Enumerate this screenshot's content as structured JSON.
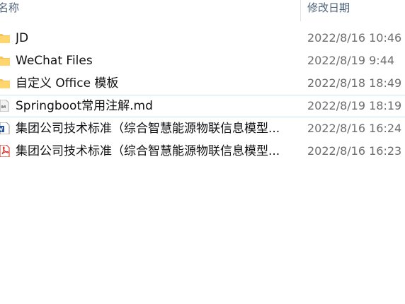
{
  "columns": {
    "name": "名称",
    "modified": "修改日期"
  },
  "files": [
    {
      "name": "JD",
      "modified": "2022/8/16 10:46",
      "icon": "folder-icon",
      "color": "#f4c25b"
    },
    {
      "name": "WeChat Files",
      "modified": "2022/8/19 9:44",
      "icon": "folder-icon",
      "color": "#f4c25b"
    },
    {
      "name": "自定义 Office 模板",
      "modified": "2022/8/18 18:49",
      "icon": "folder-icon",
      "color": "#f4c25b"
    },
    {
      "name": "Springboot常用注解.md",
      "modified": "2022/8/19 18:19",
      "icon": "markdown-file-icon",
      "focused": true
    },
    {
      "name": "集团公司技术标准（综合智慧能源物联信息模型...",
      "modified": "2022/8/16 16:24",
      "icon": "word-document-icon",
      "color": "#2b579a"
    },
    {
      "name": "集团公司技术标准（综合智慧能源物联信息模型...",
      "modified": "2022/8/16 16:23",
      "icon": "pdf-file-icon",
      "color": "#d9261c"
    }
  ]
}
